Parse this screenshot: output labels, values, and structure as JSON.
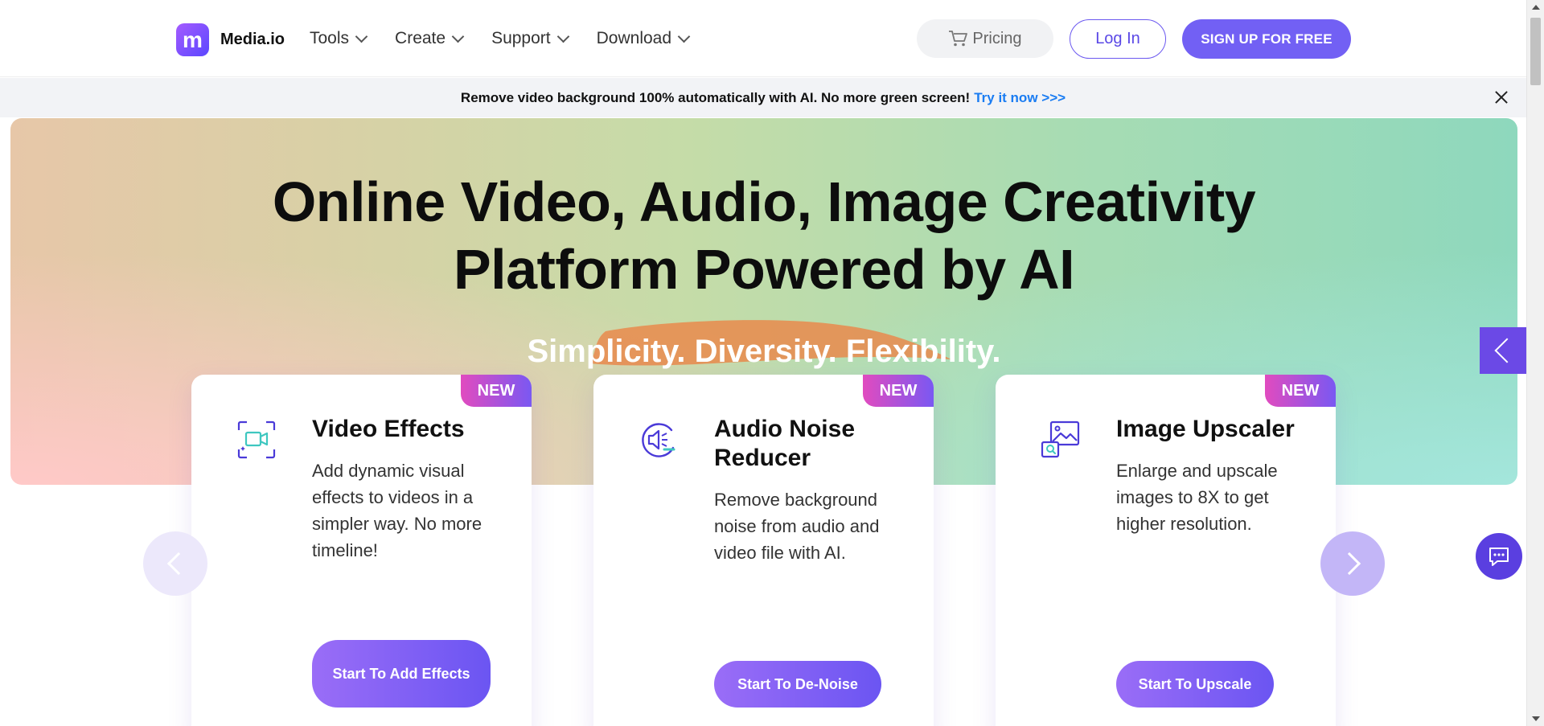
{
  "header": {
    "brand": "Media.io",
    "logo_letter": "m",
    "nav": [
      {
        "label": "Tools"
      },
      {
        "label": "Create"
      },
      {
        "label": "Support"
      },
      {
        "label": "Download"
      }
    ],
    "pricing_label": "Pricing",
    "login_label": "Log In",
    "signup_label": "SIGN UP FOR FREE"
  },
  "banner": {
    "text": "Remove video background 100% automatically with AI. No more green screen!",
    "link": "Try it now >>>"
  },
  "hero": {
    "title_line1": "Online Video, Audio, Image Creativity",
    "title_line2": "Platform Powered by AI",
    "subtitle": "Simplicity. Diversity. Flexibility."
  },
  "cards": [
    {
      "badge": "NEW",
      "title": "Video Effects",
      "description": "Add dynamic visual effects to videos in a simpler way. No more timeline!",
      "cta": "Start To Add Effects",
      "icon": "video-effects-icon"
    },
    {
      "badge": "NEW",
      "title": "Audio Noise Reducer",
      "description": "Remove background noise from audio and video file with AI.",
      "cta": "Start To De-Noise",
      "icon": "audio-noise-icon"
    },
    {
      "badge": "NEW",
      "title": "Image Upscaler",
      "description": "Enlarge and upscale images to 8X to get higher resolution.",
      "cta": "Start To Upscale",
      "icon": "image-upscale-icon"
    }
  ],
  "colors": {
    "accent": "#7260f4",
    "link": "#1a7cf2",
    "badge_start": "#e14bbf",
    "badge_end": "#7a58f2"
  }
}
